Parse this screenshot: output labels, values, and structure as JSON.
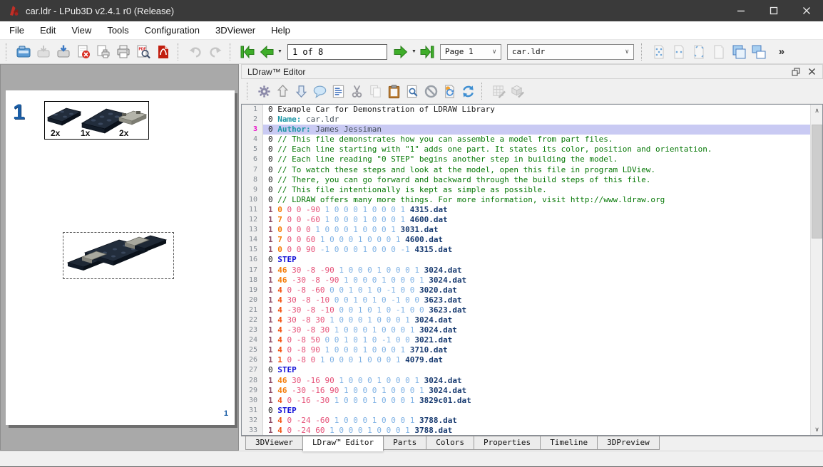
{
  "window": {
    "title": "car.ldr - LPub3D v2.4.1 r0 (Release)",
    "controls": [
      "minimize",
      "maximize",
      "close"
    ]
  },
  "menu": [
    "File",
    "Edit",
    "View",
    "Tools",
    "Configuration",
    "3DViewer",
    "Help"
  ],
  "main_toolbar": {
    "items": [
      {
        "kind": "sep"
      },
      {
        "kind": "icon",
        "icon": "open",
        "name": "open-file"
      },
      {
        "kind": "icon",
        "icon": "save",
        "name": "save-file",
        "disabled": true
      },
      {
        "kind": "icon",
        "icon": "save-as",
        "name": "save-as"
      },
      {
        "kind": "icon",
        "icon": "close-doc",
        "name": "close-file"
      },
      {
        "kind": "icon",
        "icon": "print-preview",
        "name": "print-preview"
      },
      {
        "kind": "icon",
        "icon": "print",
        "name": "print-file"
      },
      {
        "kind": "icon",
        "icon": "pdf-preview",
        "name": "export-pdf-preview"
      },
      {
        "kind": "icon",
        "icon": "export-pdf",
        "name": "export-pdf"
      },
      {
        "kind": "sep"
      },
      {
        "kind": "icon",
        "icon": "undo",
        "name": "undo",
        "disabled": true
      },
      {
        "kind": "icon",
        "icon": "redo",
        "name": "redo",
        "disabled": true
      },
      {
        "kind": "sep"
      },
      {
        "kind": "icon",
        "icon": "nav-first",
        "name": "first-page"
      },
      {
        "kind": "icon",
        "icon": "nav-prev",
        "name": "previous-page",
        "caret": true
      },
      {
        "kind": "input",
        "name": "page-range-input",
        "value": "1 of 8"
      },
      {
        "kind": "icon",
        "icon": "nav-next",
        "name": "next-page",
        "caret": true
      },
      {
        "kind": "icon",
        "icon": "nav-last",
        "name": "last-page"
      },
      {
        "kind": "combo",
        "name": "page-select",
        "value": "Page 1",
        "cls": "combo-page"
      },
      {
        "kind": "combo",
        "name": "file-select",
        "value": "car.ldr",
        "cls": "combo-file"
      },
      {
        "kind": "sep"
      },
      {
        "kind": "icon",
        "icon": "page-full",
        "name": "fit-width",
        "disabled": true
      },
      {
        "kind": "icon",
        "icon": "page-half",
        "name": "fit-visible",
        "disabled": true
      },
      {
        "kind": "icon",
        "icon": "page-corners",
        "name": "fit-scene",
        "disabled": true
      },
      {
        "kind": "icon",
        "icon": "page-plain",
        "name": "actual-size",
        "disabled": true
      },
      {
        "kind": "icon",
        "icon": "cascade",
        "name": "cascade-windows"
      },
      {
        "kind": "icon",
        "icon": "tile",
        "name": "tile-windows"
      },
      {
        "kind": "overflow",
        "name": "toolbar-overflow",
        "label": "»"
      }
    ]
  },
  "editor": {
    "title": "LDraw™ Editor",
    "toolbar": [
      {
        "kind": "sep"
      },
      {
        "kind": "icon",
        "icon": "gear",
        "name": "preferences"
      },
      {
        "kind": "icon",
        "icon": "doc-up",
        "name": "upload"
      },
      {
        "kind": "icon",
        "icon": "doc-down",
        "name": "download"
      },
      {
        "kind": "icon",
        "icon": "comment",
        "name": "add-comment"
      },
      {
        "kind": "icon",
        "icon": "format",
        "name": "format-document"
      },
      {
        "kind": "icon",
        "icon": "cut",
        "name": "cut"
      },
      {
        "kind": "icon",
        "icon": "copy",
        "name": "copy",
        "disabled": true
      },
      {
        "kind": "icon",
        "icon": "paste",
        "name": "paste"
      },
      {
        "kind": "icon",
        "icon": "find",
        "name": "find"
      },
      {
        "kind": "icon",
        "icon": "ban",
        "name": "cancel-edit"
      },
      {
        "kind": "icon",
        "icon": "update",
        "name": "update-model"
      },
      {
        "kind": "icon",
        "icon": "refresh",
        "name": "refresh"
      },
      {
        "kind": "sep"
      },
      {
        "kind": "icon",
        "icon": "palette-edit",
        "name": "edit-color",
        "disabled": true
      },
      {
        "kind": "icon",
        "icon": "part-edit",
        "name": "edit-part",
        "disabled": true
      }
    ],
    "active_line": 3,
    "lines": [
      {
        "n": 1,
        "seg": [
          [
            "p",
            "0 Example Car for Demonstration of LDRAW Library"
          ]
        ]
      },
      {
        "n": 2,
        "seg": [
          [
            "p",
            "0 "
          ],
          [
            "m",
            "Name: "
          ],
          [
            "v",
            "car.ldr"
          ]
        ]
      },
      {
        "n": 3,
        "hl": true,
        "seg": [
          [
            "p",
            "0 "
          ],
          [
            "m",
            "Author: "
          ],
          [
            "v",
            "James Jessiman"
          ]
        ]
      },
      {
        "n": 4,
        "seg": [
          [
            "p",
            "0 "
          ],
          [
            "c",
            "// This file demonstrates how you can assemble a model from part files."
          ]
        ]
      },
      {
        "n": 5,
        "seg": [
          [
            "p",
            "0 "
          ],
          [
            "c",
            "// Each line starting with \"1\" adds one part. It states its color, position and orientation."
          ]
        ]
      },
      {
        "n": 6,
        "seg": [
          [
            "p",
            "0 "
          ],
          [
            "c",
            "// Each line reading \"0 STEP\" begins another step in building the model."
          ]
        ]
      },
      {
        "n": 7,
        "seg": [
          [
            "p",
            "0 "
          ],
          [
            "c",
            "// To watch these steps and look at the model, open this file in program LDView."
          ]
        ]
      },
      {
        "n": 8,
        "seg": [
          [
            "p",
            "0 "
          ],
          [
            "c",
            "// There, you can go forward and backward through the build steps of this file."
          ]
        ]
      },
      {
        "n": 9,
        "seg": [
          [
            "p",
            "0 "
          ],
          [
            "c",
            "// This file intentionally is kept as simple as possible."
          ]
        ]
      },
      {
        "n": 10,
        "seg": [
          [
            "p",
            "0 "
          ],
          [
            "c",
            "// LDRAW offers many more things. For more information, visit http://www.ldraw.org"
          ]
        ]
      },
      {
        "n": 11,
        "seg": [
          [
            "l",
            "1 "
          ],
          [
            "o",
            "0 "
          ],
          [
            "x",
            "0 0 -90 "
          ],
          [
            "b",
            "1 0 0 0 1 0 0 0 1 "
          ],
          [
            "f",
            "4315.dat"
          ]
        ]
      },
      {
        "n": 12,
        "seg": [
          [
            "l",
            "1 "
          ],
          [
            "o",
            "7 "
          ],
          [
            "x",
            "0 0 -60 "
          ],
          [
            "b",
            "1 0 0 0 1 0 0 0 1 "
          ],
          [
            "f",
            "4600.dat"
          ]
        ]
      },
      {
        "n": 13,
        "seg": [
          [
            "l",
            "1 "
          ],
          [
            "o",
            "0 "
          ],
          [
            "x",
            "0 0 0 "
          ],
          [
            "b",
            "1 0 0 0 1 0 0 0 1 "
          ],
          [
            "f",
            "3031.dat"
          ]
        ]
      },
      {
        "n": 14,
        "seg": [
          [
            "l",
            "1 "
          ],
          [
            "o",
            "7 "
          ],
          [
            "x",
            "0 0 60 "
          ],
          [
            "b",
            "1 0 0 0 1 0 0 0 1 "
          ],
          [
            "f",
            "4600.dat"
          ]
        ]
      },
      {
        "n": 15,
        "seg": [
          [
            "l",
            "1 "
          ],
          [
            "o",
            "0 "
          ],
          [
            "x",
            "0 0 90 "
          ],
          [
            "b",
            "-1 0 0 0 1 0 0 0 -1 "
          ],
          [
            "f",
            "4315.dat"
          ]
        ]
      },
      {
        "n": 16,
        "seg": [
          [
            "p",
            "0 "
          ],
          [
            "s",
            "STEP"
          ]
        ]
      },
      {
        "n": 17,
        "seg": [
          [
            "l",
            "1 "
          ],
          [
            "o",
            "46 "
          ],
          [
            "x",
            "30 -8 -90 "
          ],
          [
            "b",
            "1 0 0 0 1 0 0 0 1 "
          ],
          [
            "f",
            "3024.dat"
          ]
        ]
      },
      {
        "n": 18,
        "seg": [
          [
            "l",
            "1 "
          ],
          [
            "o",
            "46 "
          ],
          [
            "x",
            "-30 -8 -90 "
          ],
          [
            "b",
            "1 0 0 0 1 0 0 0 1 "
          ],
          [
            "f",
            "3024.dat"
          ]
        ]
      },
      {
        "n": 19,
        "seg": [
          [
            "l",
            "1 "
          ],
          [
            "r",
            "4 "
          ],
          [
            "x",
            "0 -8 -60 "
          ],
          [
            "b",
            "0 0 1 0 1 0 -1 0 0 "
          ],
          [
            "f",
            "3020.dat"
          ]
        ]
      },
      {
        "n": 20,
        "seg": [
          [
            "l",
            "1 "
          ],
          [
            "r",
            "4 "
          ],
          [
            "x",
            "30 -8 -10 "
          ],
          [
            "b",
            "0 0 1 0 1 0 -1 0 0 "
          ],
          [
            "f",
            "3623.dat"
          ]
        ]
      },
      {
        "n": 21,
        "seg": [
          [
            "l",
            "1 "
          ],
          [
            "r",
            "4 "
          ],
          [
            "x",
            "-30 -8 -10 "
          ],
          [
            "b",
            "0 0 1 0 1 0 -1 0 0 "
          ],
          [
            "f",
            "3623.dat"
          ]
        ]
      },
      {
        "n": 22,
        "seg": [
          [
            "l",
            "1 "
          ],
          [
            "r",
            "4 "
          ],
          [
            "x",
            "30 -8 30 "
          ],
          [
            "b",
            "1 0 0 0 1 0 0 0 1 "
          ],
          [
            "f",
            "3024.dat"
          ]
        ]
      },
      {
        "n": 23,
        "seg": [
          [
            "l",
            "1 "
          ],
          [
            "r",
            "4 "
          ],
          [
            "x",
            "-30 -8 30 "
          ],
          [
            "b",
            "1 0 0 0 1 0 0 0 1 "
          ],
          [
            "f",
            "3024.dat"
          ]
        ]
      },
      {
        "n": 24,
        "seg": [
          [
            "l",
            "1 "
          ],
          [
            "r",
            "4 "
          ],
          [
            "x",
            "0 -8 50 "
          ],
          [
            "b",
            "0 0 1 0 1 0 -1 0 0 "
          ],
          [
            "f",
            "3021.dat"
          ]
        ]
      },
      {
        "n": 25,
        "seg": [
          [
            "l",
            "1 "
          ],
          [
            "r",
            "4 "
          ],
          [
            "x",
            "0 -8 90 "
          ],
          [
            "b",
            "1 0 0 0 1 0 0 0 1 "
          ],
          [
            "f",
            "3710.dat"
          ]
        ]
      },
      {
        "n": 26,
        "seg": [
          [
            "l",
            "1 "
          ],
          [
            "r",
            "1 "
          ],
          [
            "x",
            "0 -8 0 "
          ],
          [
            "b",
            "1 0 0 0 1 0 0 0 1 "
          ],
          [
            "f",
            "4079.dat"
          ]
        ]
      },
      {
        "n": 27,
        "seg": [
          [
            "p",
            "0 "
          ],
          [
            "s",
            "STEP"
          ]
        ]
      },
      {
        "n": 28,
        "seg": [
          [
            "l",
            "1 "
          ],
          [
            "o",
            "46 "
          ],
          [
            "x",
            "30 -16 90 "
          ],
          [
            "b",
            "1 0 0 0 1 0 0 0 1 "
          ],
          [
            "f",
            "3024.dat"
          ]
        ]
      },
      {
        "n": 29,
        "seg": [
          [
            "l",
            "1 "
          ],
          [
            "o",
            "46 "
          ],
          [
            "x",
            "-30 -16 90 "
          ],
          [
            "b",
            "1 0 0 0 1 0 0 0 1 "
          ],
          [
            "f",
            "3024.dat"
          ]
        ]
      },
      {
        "n": 30,
        "seg": [
          [
            "l",
            "1 "
          ],
          [
            "r",
            "4 "
          ],
          [
            "x",
            "0 -16 -30 "
          ],
          [
            "b",
            "1 0 0 0 1 0 0 0 1 "
          ],
          [
            "f",
            "3829c01.dat"
          ]
        ]
      },
      {
        "n": 31,
        "seg": [
          [
            "p",
            "0 "
          ],
          [
            "s",
            "STEP"
          ]
        ]
      },
      {
        "n": 32,
        "seg": [
          [
            "l",
            "1 "
          ],
          [
            "r",
            "4 "
          ],
          [
            "x",
            "0 -24 -60 "
          ],
          [
            "b",
            "1 0 0 0 1 0 0 0 1 "
          ],
          [
            "f",
            "3788.dat"
          ]
        ]
      },
      {
        "n": 33,
        "seg": [
          [
            "l",
            "1 "
          ],
          [
            "r",
            "4 "
          ],
          [
            "x",
            "0 -24 60 "
          ],
          [
            "b",
            "1 0 0 0 1 0 0 0 1 "
          ],
          [
            "f",
            "3788.dat"
          ]
        ]
      }
    ]
  },
  "tabs": [
    {
      "label": "3DViewer",
      "active": false
    },
    {
      "label": "LDraw™ Editor",
      "active": true
    },
    {
      "label": "Parts",
      "active": false
    },
    {
      "label": "Colors",
      "active": false
    },
    {
      "label": "Properties",
      "active": false
    },
    {
      "label": "Timeline",
      "active": false
    },
    {
      "label": "3DPreview",
      "active": false
    }
  ],
  "preview": {
    "step_number": "1",
    "pli": {
      "counts": [
        "2x",
        "1x",
        "2x"
      ]
    },
    "page_number": "1"
  },
  "colors": {
    "title_bar": "#3a3a3a",
    "accent_green": "#3fae2a",
    "preview_background": "#a9a9a9",
    "line_highlight": "#c9caf3",
    "active_line_number": "#e912c9",
    "step_number_blue": "#1b5ea6",
    "comment_green": "#067806",
    "meta_teal": "#1d96a4",
    "part_navy": "#173a70",
    "step_keyword_blue": "#1513d8",
    "color_code_orange": "#f57d0a",
    "color_code_red": "#f2500f",
    "position_rose": "#e65178",
    "matrix_blue": "#7fb2e5",
    "line_type_plum": "#8b4963"
  }
}
